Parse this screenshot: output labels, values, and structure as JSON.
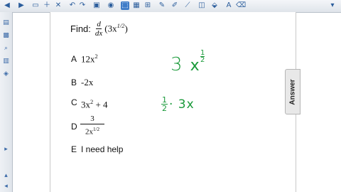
{
  "question": {
    "prefix": "Find:",
    "d_num": "d",
    "d_den": "dx",
    "expression": "(3x",
    "exponent": "1/2",
    "close": ")"
  },
  "options": [
    {
      "letter": "A",
      "base": "12x",
      "sup": "2",
      "tail": ""
    },
    {
      "letter": "B",
      "base": "-2x",
      "sup": "",
      "tail": ""
    },
    {
      "letter": "C",
      "base": "3x",
      "sup": "2",
      "tail": " + 4"
    },
    {
      "letter": "D",
      "frac_num": "3",
      "frac_den": "2x",
      "frac_den_sup": "1/2"
    },
    {
      "letter": "E",
      "text": "I need help"
    }
  ],
  "answer_tab": "Answer",
  "handwriting": {
    "line1_a": "3",
    "line1_b": "x",
    "line1_num": "1",
    "line1_den": "2",
    "line2_num": "1",
    "line2_den": "2",
    "line2_rest": "· 3x"
  },
  "colors": {
    "ink": "#1a9a3a",
    "accent": "#2b5d9c"
  }
}
